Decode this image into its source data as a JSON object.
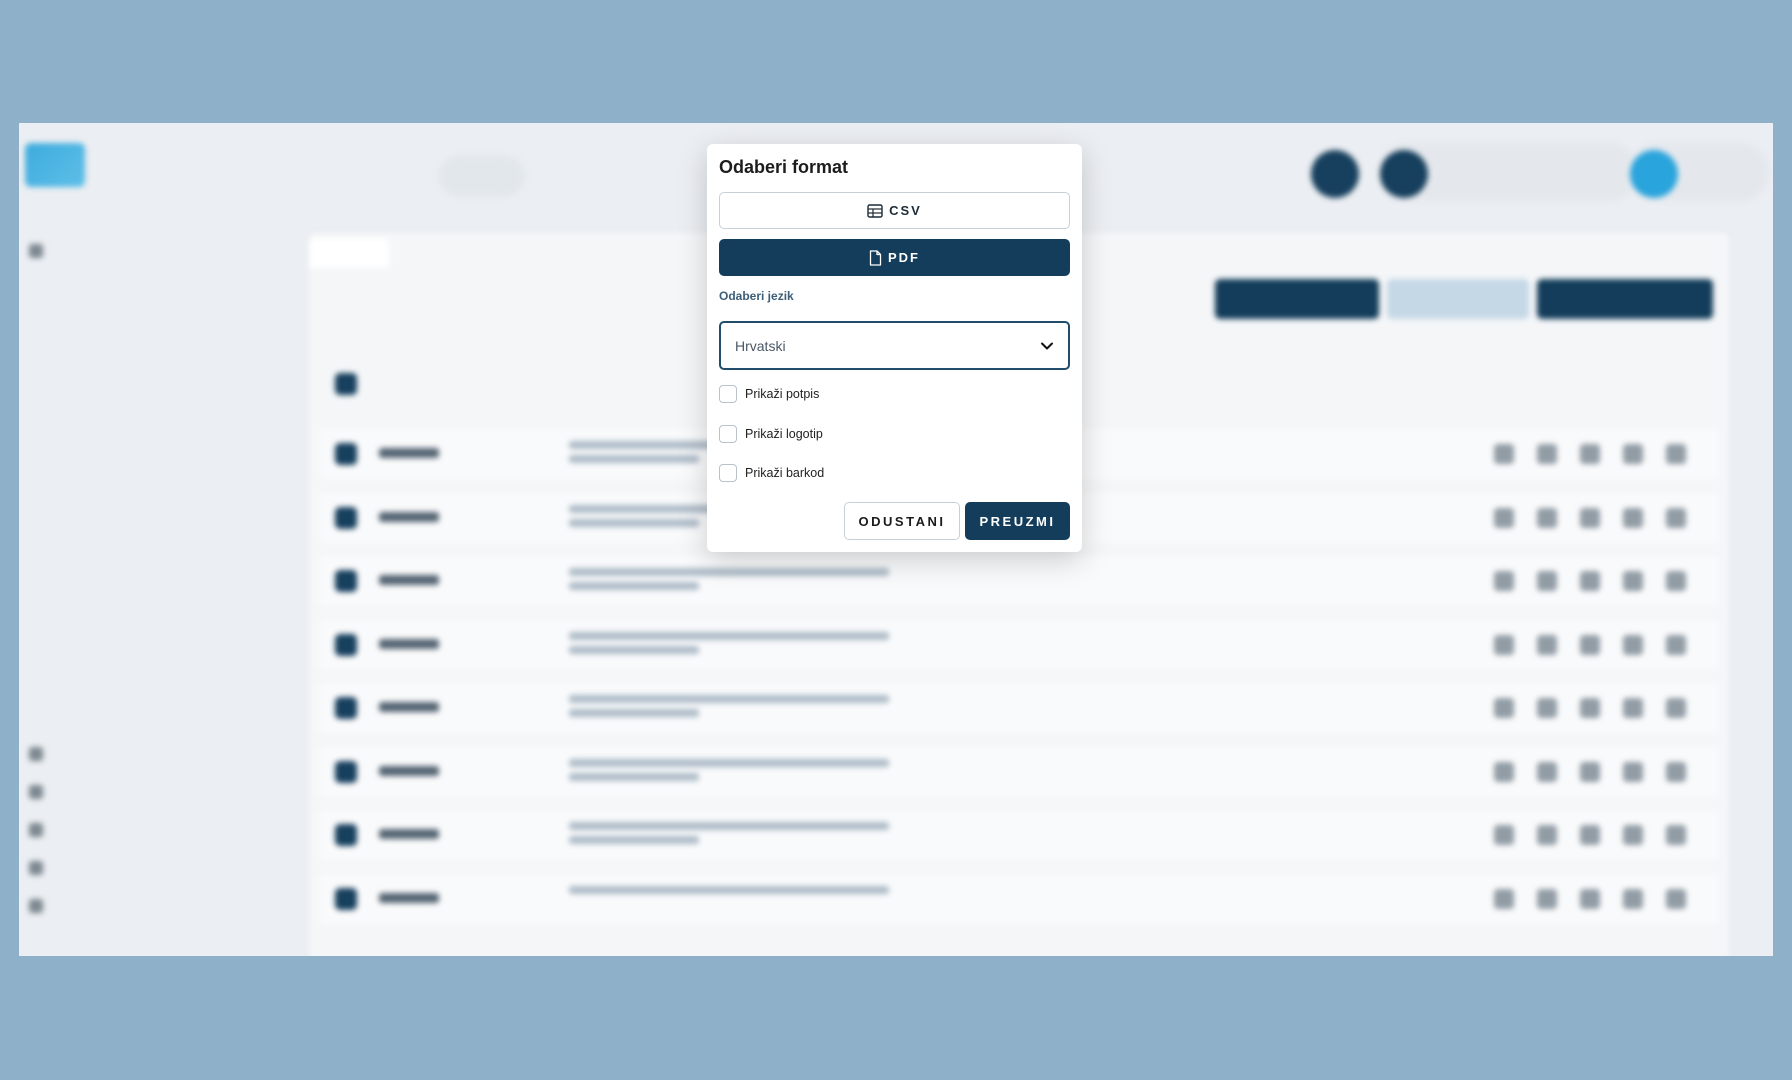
{
  "modal": {
    "title": "Odaberi format",
    "csv_label": "CSV",
    "pdf_label": "PDF",
    "language_label": "Odaberi jezik",
    "language_value": "Hrvatski",
    "checkboxes": [
      {
        "label": "Prikaži potpis",
        "checked": false
      },
      {
        "label": "Prikaži logotip",
        "checked": false
      },
      {
        "label": "Prikaži barkod",
        "checked": false
      }
    ],
    "cancel_label": "ODUSTANI",
    "download_label": "PREUZMI"
  },
  "colors": {
    "primary": "#133d5b",
    "backdrop": "#8eb0c8",
    "select_border": "#214c6b"
  }
}
